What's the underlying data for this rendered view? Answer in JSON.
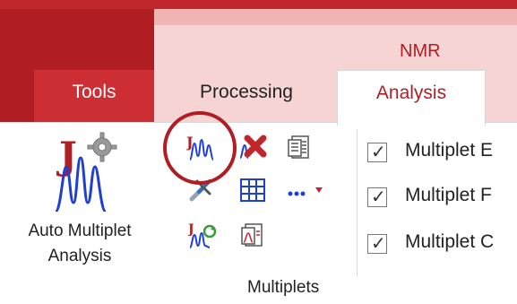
{
  "ribbon": {
    "context_tab_group": "NMR",
    "tabs": [
      {
        "label": "Tools"
      },
      {
        "label": "Processing"
      },
      {
        "label": "Analysis"
      }
    ],
    "auto_multiplet": {
      "label_line1": "Auto Multiplet",
      "label_line2": "Analysis",
      "icon": "auto-multiplet-icon"
    },
    "small_tools": [
      {
        "icon": "manual-multiplet-icon"
      },
      {
        "icon": "delete-multiplet-icon"
      },
      {
        "icon": "multiplet-report-icon"
      },
      {
        "icon": "multiplet-tools-icon"
      },
      {
        "icon": "multiplet-table-icon"
      },
      {
        "icon": "more-options-icon"
      },
      {
        "icon": "multiplet-refresh-icon"
      },
      {
        "icon": "multiplet-report-chart-icon"
      }
    ],
    "checkboxes": [
      {
        "label": "Multiplet E",
        "checked": true
      },
      {
        "label": "Multiplet F",
        "checked": true
      },
      {
        "label": "Multiplet C",
        "checked": true
      }
    ],
    "group_label": "Multiplets",
    "colors": {
      "accent_red": "#b01e24",
      "tab_red": "#cc2e33",
      "pink": "#f7d4d4",
      "peak_blue": "#1f3fd0"
    }
  }
}
